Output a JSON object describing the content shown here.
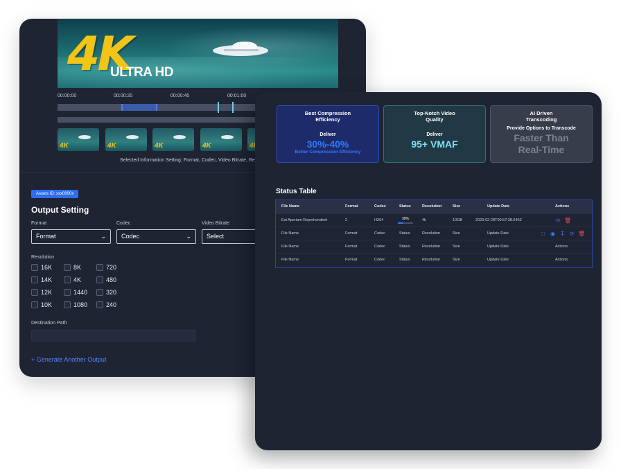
{
  "left_panel": {
    "hero": {
      "logo_big": "4K",
      "logo_small": "ULTRA HD"
    },
    "timeline": {
      "labels": [
        "00:00:00",
        "00:00:20",
        "00:00:40",
        "00:01:00"
      ]
    },
    "thumbnail_logo": "4K",
    "selected_info": "Selected Information Setting: Format, Codec, Video Bitrate, Reso",
    "asset_badge": "Assets ID: xxx0000x",
    "output_title": "Output Setting",
    "fields": {
      "format_label": "Format",
      "format_value": "Format",
      "codec_label": "Codec",
      "codec_value": "Codec",
      "bitrate_label": "Video Bitrate",
      "bitrate_value": "Select"
    },
    "resolution_label": "Resolution",
    "resolutions": [
      "16K",
      "8K",
      "720",
      "14K",
      "4K",
      "480",
      "12K",
      "1440",
      "320",
      "10K",
      "1080",
      "240"
    ],
    "destination_label": "Destination Path",
    "generate_link": "+ Generate Another Output"
  },
  "right_panel": {
    "features": [
      {
        "title": "Best Compression Efficiency",
        "deliver": "Deliver",
        "big": "30%-40%",
        "note": "Better Compression Efficiency"
      },
      {
        "title": "Top-Notch Video Quality",
        "deliver": "Deliver",
        "big": "95+ VMAF",
        "note": ""
      },
      {
        "title": "AI Driven Transcoding",
        "deliver": "Provide Options to Transcode",
        "big": "Faster Than Real-Time",
        "note": ""
      }
    ],
    "status_title": "Status Table",
    "table": {
      "headers": [
        "File Name",
        "Format",
        "Codec",
        "Status",
        "Resolution",
        "Size",
        "Update Date",
        "Actions"
      ],
      "row1": {
        "file": "Est Aperiam Reprehenderit",
        "format": "2",
        "codec": "H264",
        "status": "30%",
        "status_progress": 0.3,
        "resolution": "4k",
        "size": "10GB",
        "date": "2023-02-28T00:57:38.640Z"
      },
      "rows": [
        {
          "file": "File Name",
          "format": "Format",
          "codec": "Codec",
          "status": "Status",
          "resolution": "Resolution",
          "size": "Size",
          "date": "Update Date",
          "actions": ""
        },
        {
          "file": "File Name",
          "format": "Format",
          "codec": "Codec",
          "status": "Status",
          "resolution": "Resolution",
          "size": "Size",
          "date": "Update Date",
          "actions": "Actions"
        },
        {
          "file": "File Name",
          "format": "Format",
          "codec": "Codec",
          "status": "Status",
          "resolution": "Resolution",
          "size": "Size",
          "date": "Update Date",
          "actions": "Actions"
        }
      ]
    }
  },
  "colors": {
    "panel_bg": "#1f2433",
    "accent_blue": "#2f6df0",
    "logo_yellow": "#f2c417",
    "danger": "#e5484d"
  },
  "icons": [
    "chevron-down-icon",
    "refresh-icon",
    "trash-icon",
    "folder-icon",
    "eye-icon",
    "download-icon"
  ]
}
